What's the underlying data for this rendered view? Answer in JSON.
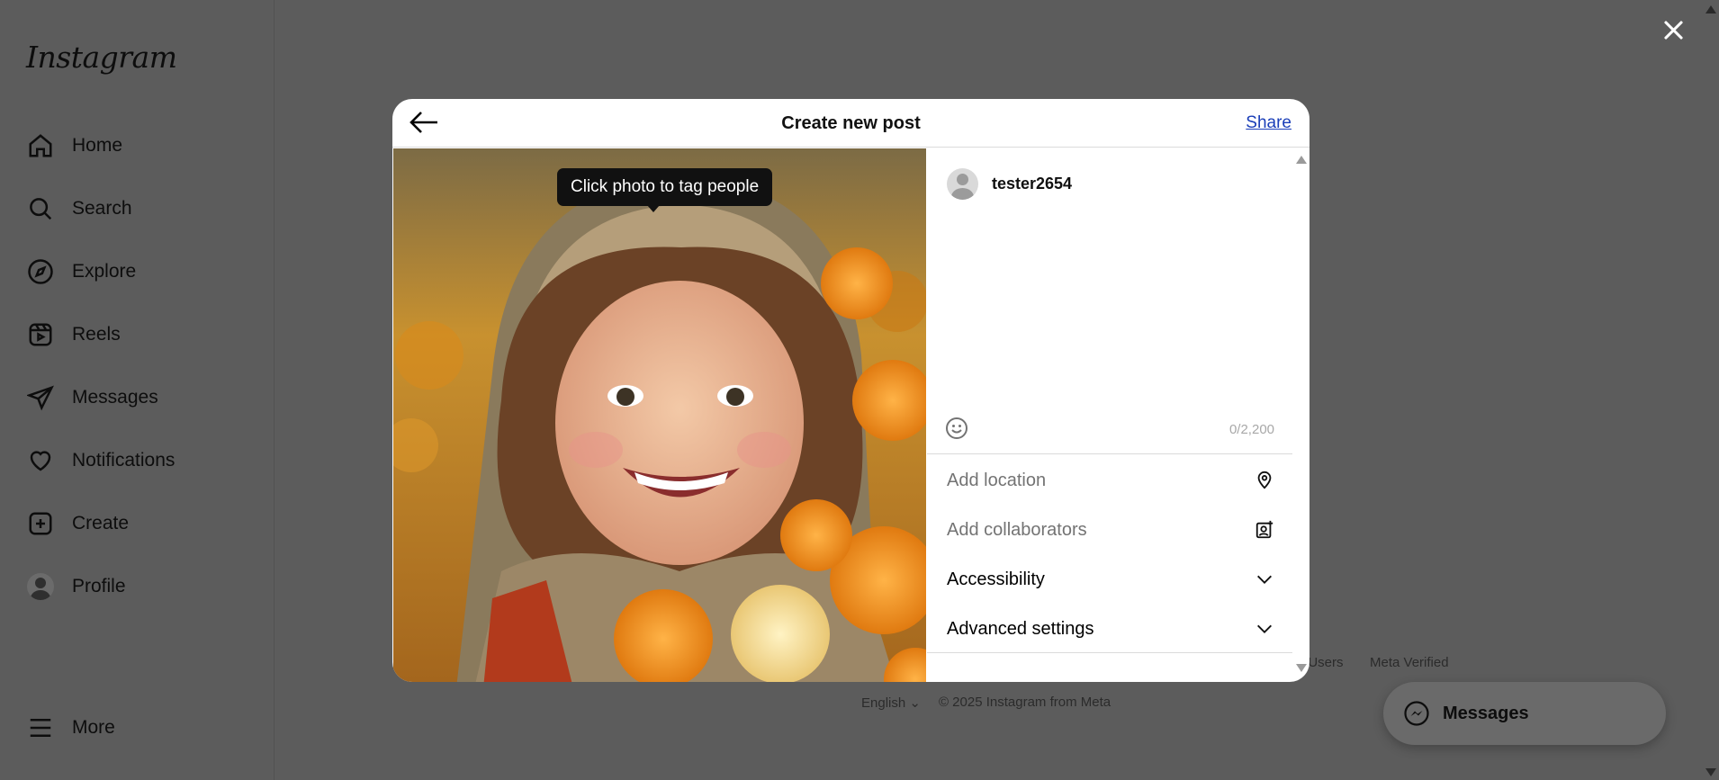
{
  "app": {
    "logo": "Instagram"
  },
  "sidebar": {
    "items": [
      {
        "label": "Home",
        "icon": "home-icon"
      },
      {
        "label": "Search",
        "icon": "search-icon"
      },
      {
        "label": "Explore",
        "icon": "compass-icon"
      },
      {
        "label": "Reels",
        "icon": "reels-icon"
      },
      {
        "label": "Messages",
        "icon": "send-icon"
      },
      {
        "label": "Notifications",
        "icon": "heart-icon"
      },
      {
        "label": "Create",
        "icon": "plus-square-icon"
      },
      {
        "label": "Profile",
        "icon": "avatar"
      }
    ],
    "more_label": "More"
  },
  "background_footer": {
    "links_tail": [
      "n-Users",
      "Meta Verified"
    ],
    "language": "English",
    "copyright": "© 2025 Instagram from Meta"
  },
  "messages_pill": {
    "label": "Messages"
  },
  "modal": {
    "title": "Create new post",
    "share_label": "Share",
    "tooltip": "Click photo to tag people",
    "username": "tester2654",
    "char_count": "0/2,200",
    "options": {
      "location": "Add location",
      "collaborators": "Add collaborators",
      "accessibility": "Accessibility",
      "advanced": "Advanced settings"
    }
  },
  "colors": {
    "overlay": "#5c5c5c",
    "link": "#1a3eb8",
    "modal_bg": "#ffffff"
  }
}
